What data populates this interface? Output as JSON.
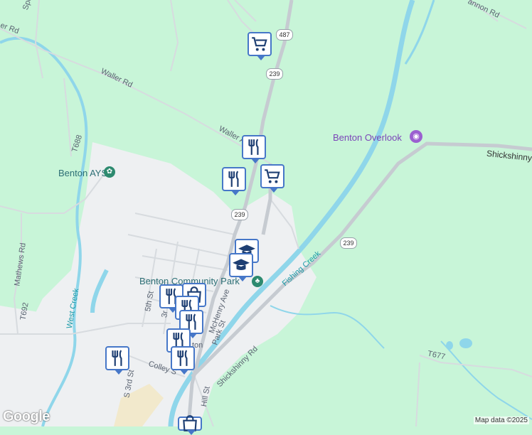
{
  "map": {
    "colors": {
      "land": "#c8f5d8",
      "urban": "#eef0f2",
      "water": "#8fd6ea",
      "road": "#c6cbd1"
    },
    "road_labels": [
      {
        "id": "spencer",
        "text": "Spencer"
      },
      {
        "id": "er-rd",
        "text": "er Rd"
      },
      {
        "id": "waller-rd",
        "text": "Waller Rd"
      },
      {
        "id": "waller-a",
        "text": "Waller A"
      },
      {
        "id": "t688",
        "text": "T688"
      },
      {
        "id": "mathews-rd",
        "text": "Mathews Rd"
      },
      {
        "id": "t692",
        "text": "T692"
      },
      {
        "id": "fifth-st",
        "text": "5th St"
      },
      {
        "id": "third",
        "text": "3r"
      },
      {
        "id": "mchenry-ave",
        "text": "McHenry Ave"
      },
      {
        "id": "park-st",
        "text": "Park St"
      },
      {
        "id": "shickshinny-rd",
        "text": "Shickshinny Rd"
      },
      {
        "id": "shickshinny-right",
        "text": "Shickshinny"
      },
      {
        "id": "colley",
        "text": "Colley S"
      },
      {
        "id": "s3rd-st",
        "text": "S 3rd St"
      },
      {
        "id": "hill-st",
        "text": "Hill St"
      },
      {
        "id": "t677",
        "text": "T677"
      },
      {
        "id": "annon-rd",
        "text": "annon Rd"
      },
      {
        "id": "ton",
        "text": "ton"
      }
    ],
    "water_labels": [
      {
        "id": "west-creek",
        "text": "West Creek"
      },
      {
        "id": "fishing-creek",
        "text": "Fishing Creek"
      }
    ],
    "poi_labels": [
      {
        "id": "benton-ayso",
        "text": "Benton AYSO"
      },
      {
        "id": "benton-community-park",
        "text": "Benton Community Park"
      },
      {
        "id": "benton-overlook",
        "text": "Benton Overlook"
      }
    ],
    "route_shields": [
      {
        "id": "r487",
        "text": "487"
      },
      {
        "id": "r239-top",
        "text": "239"
      },
      {
        "id": "r239-mid",
        "text": "239"
      },
      {
        "id": "r239-right",
        "text": "239"
      }
    ],
    "markers": [
      {
        "id": "m1",
        "icon": "shopping-cart"
      },
      {
        "id": "m2",
        "icon": "restaurant"
      },
      {
        "id": "m3",
        "icon": "restaurant"
      },
      {
        "id": "m4",
        "icon": "shopping-cart"
      },
      {
        "id": "m5",
        "icon": "school"
      },
      {
        "id": "m6",
        "icon": "school"
      },
      {
        "id": "m7",
        "icon": "restaurant"
      },
      {
        "id": "m8",
        "icon": "shopping-bag"
      },
      {
        "id": "m9",
        "icon": "restaurant"
      },
      {
        "id": "m10",
        "icon": "restaurant"
      },
      {
        "id": "m11",
        "icon": "restaurant"
      },
      {
        "id": "m12",
        "icon": "restaurant"
      },
      {
        "id": "m13",
        "icon": "restaurant"
      },
      {
        "id": "m14",
        "icon": "shopping-bag"
      }
    ],
    "attribution": "Map data ©2025",
    "logo": "Google"
  }
}
